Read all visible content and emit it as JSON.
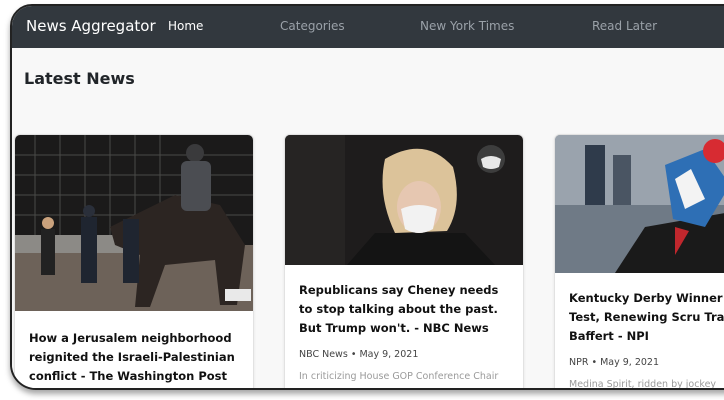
{
  "app": {
    "title": "News Aggregator"
  },
  "nav": {
    "items": [
      {
        "label": "Home",
        "active": true
      },
      {
        "label": "Categories",
        "active": false
      },
      {
        "label": "New York Times",
        "active": false
      },
      {
        "label": "Read Later",
        "active": false
      }
    ]
  },
  "main": {
    "heading": "Latest News",
    "articles": [
      {
        "title": "How a Jerusalem neighborhood reignited the Israeli-Palestinian conflict - The Washington Post",
        "source": "",
        "date": "",
        "description": "",
        "image": "mounted-police-photo"
      },
      {
        "title": "Republicans say Cheney needs to stop talking about the past. But Trump won't. - NBC News",
        "source": "NBC News",
        "date": "May 9, 2021",
        "description": "In criticizing House GOP Conference Chair",
        "image": "woman-with-mask-photo"
      },
      {
        "title": "Kentucky Derby Winner F Drug Test, Renewing Scru Trainer Bob Baffert - NPI",
        "source": "NPR",
        "date": "May 9, 2021",
        "description": "Medina Spirit, ridden by jockey",
        "image": "jockey-horse-photo"
      }
    ]
  },
  "colors": {
    "navbar": "#32383e",
    "accent": "#ffffff",
    "muted_link": "#9aa1a8"
  }
}
